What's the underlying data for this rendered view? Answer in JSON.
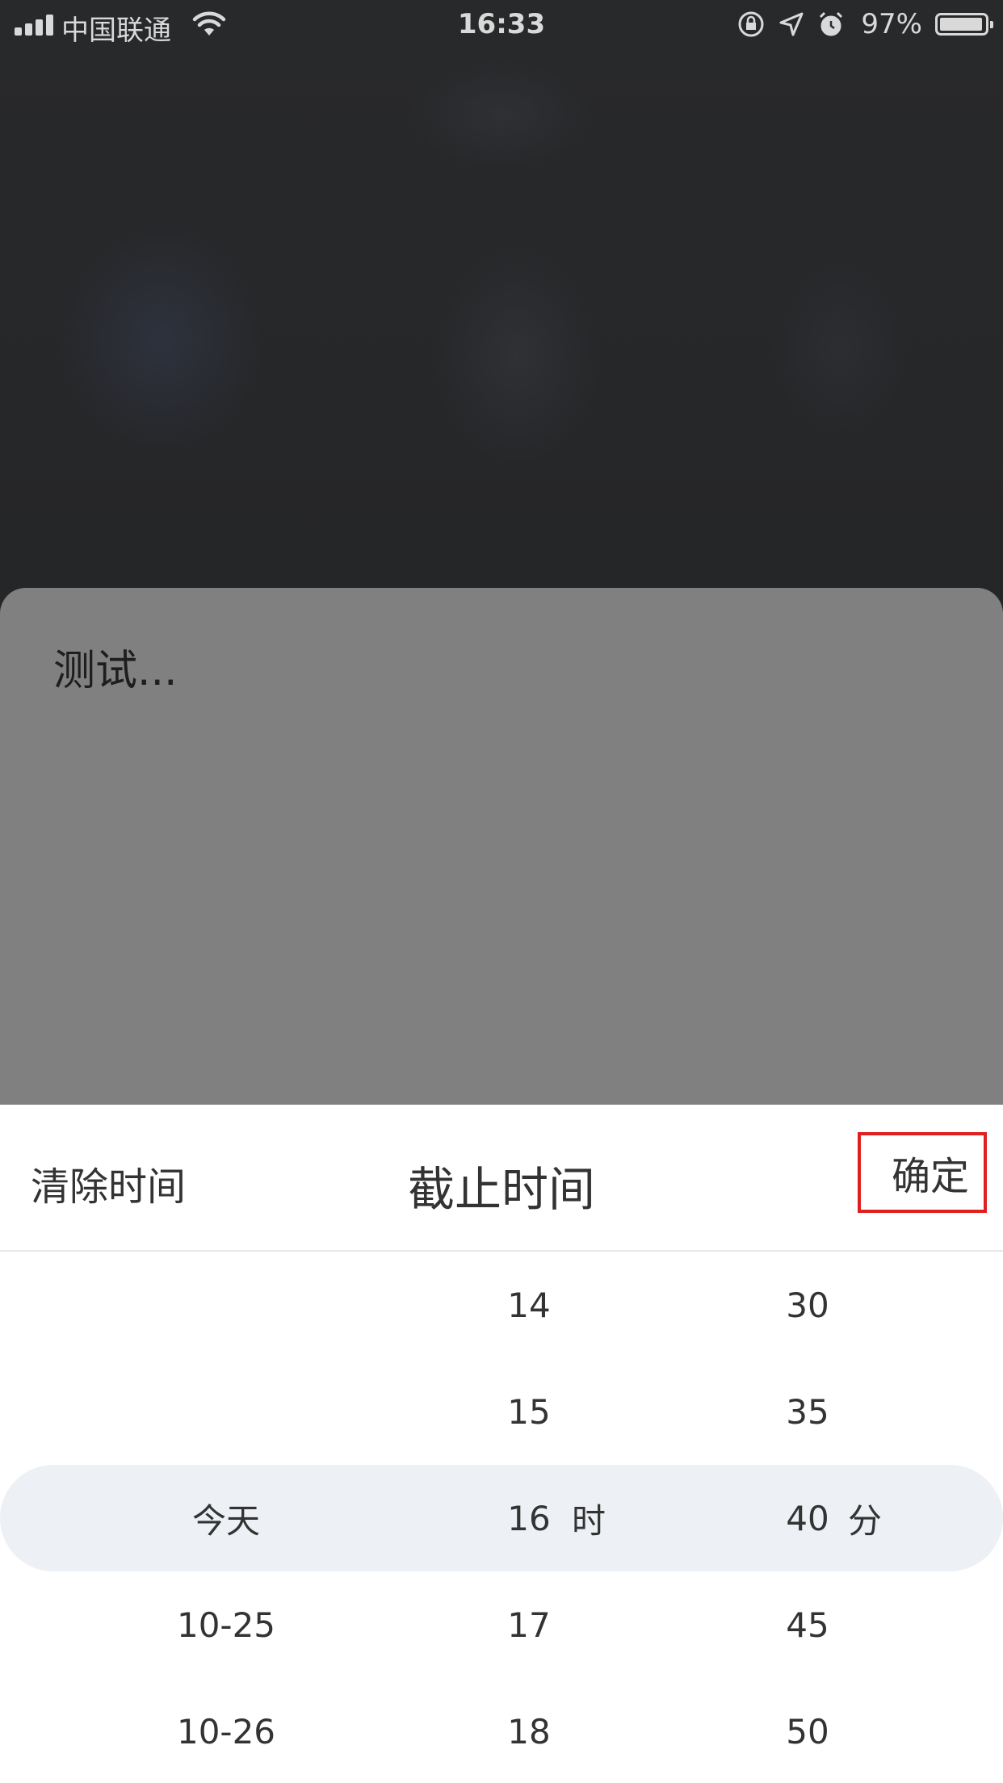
{
  "status_bar": {
    "carrier": "中国联通",
    "time": "16:33",
    "battery": "97%",
    "battery_level": 0.97,
    "icons": [
      "signal-icon",
      "wifi-icon",
      "orientation-lock-icon",
      "location-icon",
      "alarm-icon",
      "battery-icon"
    ]
  },
  "task_sheet": {
    "text": "测试..."
  },
  "picker": {
    "clear_label": "清除时间",
    "title": "截止时间",
    "confirm_label": "确定",
    "day_column": [
      "",
      "",
      "今天",
      "10-25",
      "10-26"
    ],
    "hour_column": [
      "14",
      "15",
      "16",
      "17",
      "18"
    ],
    "minute_column": [
      "30",
      "35",
      "40",
      "45",
      "50"
    ],
    "hour_unit": "时",
    "minute_unit": "分",
    "selected": {
      "day": "今天",
      "hour": "16",
      "minute": "40"
    }
  },
  "colors": {
    "confirm_highlight_border": "#e02020",
    "selection_band": "#edf0f4",
    "sheet_gray": "#808080"
  }
}
